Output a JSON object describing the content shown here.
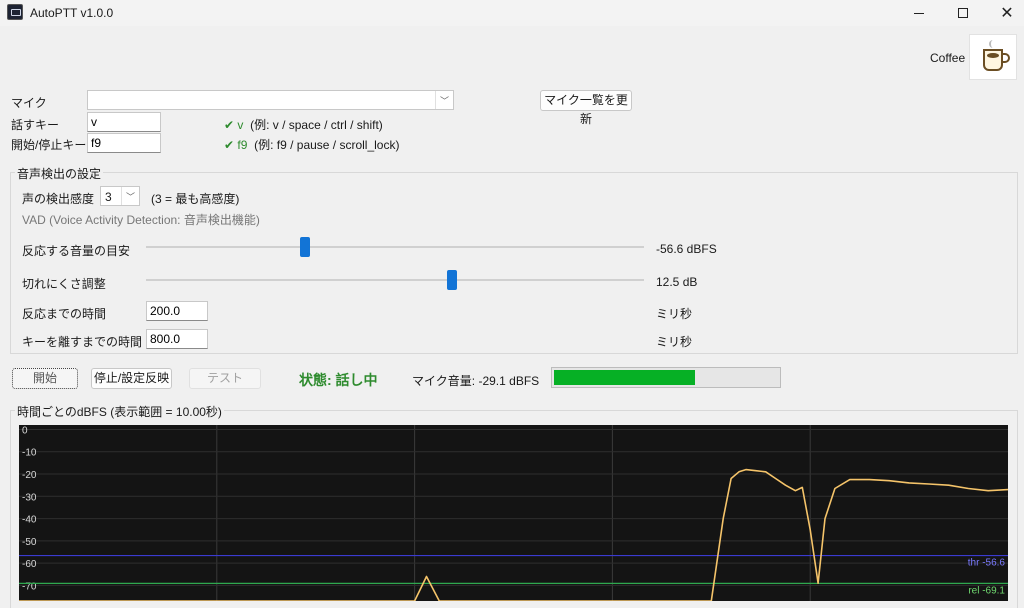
{
  "window": {
    "title": "AutoPTT v1.0.0",
    "icon": "app-icon",
    "controls": [
      "minimize-icon",
      "maximize-icon",
      "close-icon"
    ]
  },
  "coffee": {
    "label": "Coffee",
    "icon": "coffee-cup-icon"
  },
  "mic": {
    "label": "マイク",
    "value": "",
    "refresh_button": "マイク一覧を更新"
  },
  "talk_key": {
    "label": "話すキー",
    "value": "v",
    "status_mark": "✔",
    "status_key": "v",
    "hint": "(例: v / space / ctrl / shift)"
  },
  "toggle_key": {
    "label": "開始/停止キー",
    "value": "f9",
    "status_mark": "✔",
    "status_key": "f9",
    "hint": "(例: f9 / pause / scroll_lock)"
  },
  "vad_group": {
    "title": "音声検出の設定",
    "sensitivity_label": "声の検出感度",
    "sensitivity_value": "3",
    "sensitivity_note": "(3 = 最も高感度)",
    "vad_note": "VAD (Voice Activity Detection: 音声検出機能)",
    "threshold": {
      "label": "反応する音量の目安",
      "value_text": "-56.6 dBFS",
      "position": 0.32
    },
    "release": {
      "label": "切れにくさ調整",
      "value_text": "12.5 dB",
      "position": 0.615
    },
    "attack": {
      "label": "反応までの時間",
      "value": "200.0",
      "unit": "ミリ秒"
    },
    "hold": {
      "label": "キーを離すまでの時間",
      "value": "800.0",
      "unit": "ミリ秒"
    }
  },
  "controls": {
    "start": "開始",
    "stop_apply": "停止/設定反映",
    "test": "テスト",
    "status": "状態: 話し中",
    "mic_level_label": "マイク音量:",
    "mic_level_value": "-29.1 dBFS",
    "mic_level_fraction": 0.63
  },
  "chart_group": {
    "title": "時間ごとのdBFS (表示範囲 = 10.00秒)"
  },
  "chart_data": {
    "type": "line",
    "ylim": [
      -77,
      2
    ],
    "y_ticks": [
      0,
      -10,
      -20,
      -30,
      -40,
      -50,
      -60,
      -70
    ],
    "y_tick_labels": [
      "0",
      "-10",
      "-20",
      "-30",
      "-40",
      "-50",
      "-60",
      "-70"
    ],
    "xlim": [
      0,
      10
    ],
    "grid": true,
    "series": [
      {
        "color": "#f5c46a",
        "x": [
          0,
          4.0,
          4.12,
          4.25,
          7.0,
          7.12,
          7.2,
          7.28,
          7.35,
          7.45,
          7.55,
          7.65,
          7.75,
          7.85,
          7.92,
          8.0,
          8.08,
          8.15,
          8.25,
          8.4,
          8.6,
          8.8,
          9.0,
          9.2,
          9.4,
          9.6,
          9.8,
          10.0
        ],
        "y": [
          -77,
          -77,
          -66,
          -77,
          -77,
          -40,
          -22,
          -19,
          -18,
          -18.5,
          -19,
          -22,
          -25,
          -27.5,
          -26,
          -45,
          -69,
          -40,
          -26.5,
          -22.5,
          -22.5,
          -23,
          -24,
          -24.5,
          -25,
          -26.5,
          -27.5,
          -27
        ]
      }
    ],
    "threshold_lines": [
      {
        "value": -56.6,
        "label": "thr -56.6",
        "color": "#3b3bd0",
        "label_color": "#7a7aff"
      },
      {
        "value": -69.1,
        "label": "rel -69.1",
        "color": "#2fa84f",
        "label_color": "#6fd86f"
      }
    ]
  }
}
